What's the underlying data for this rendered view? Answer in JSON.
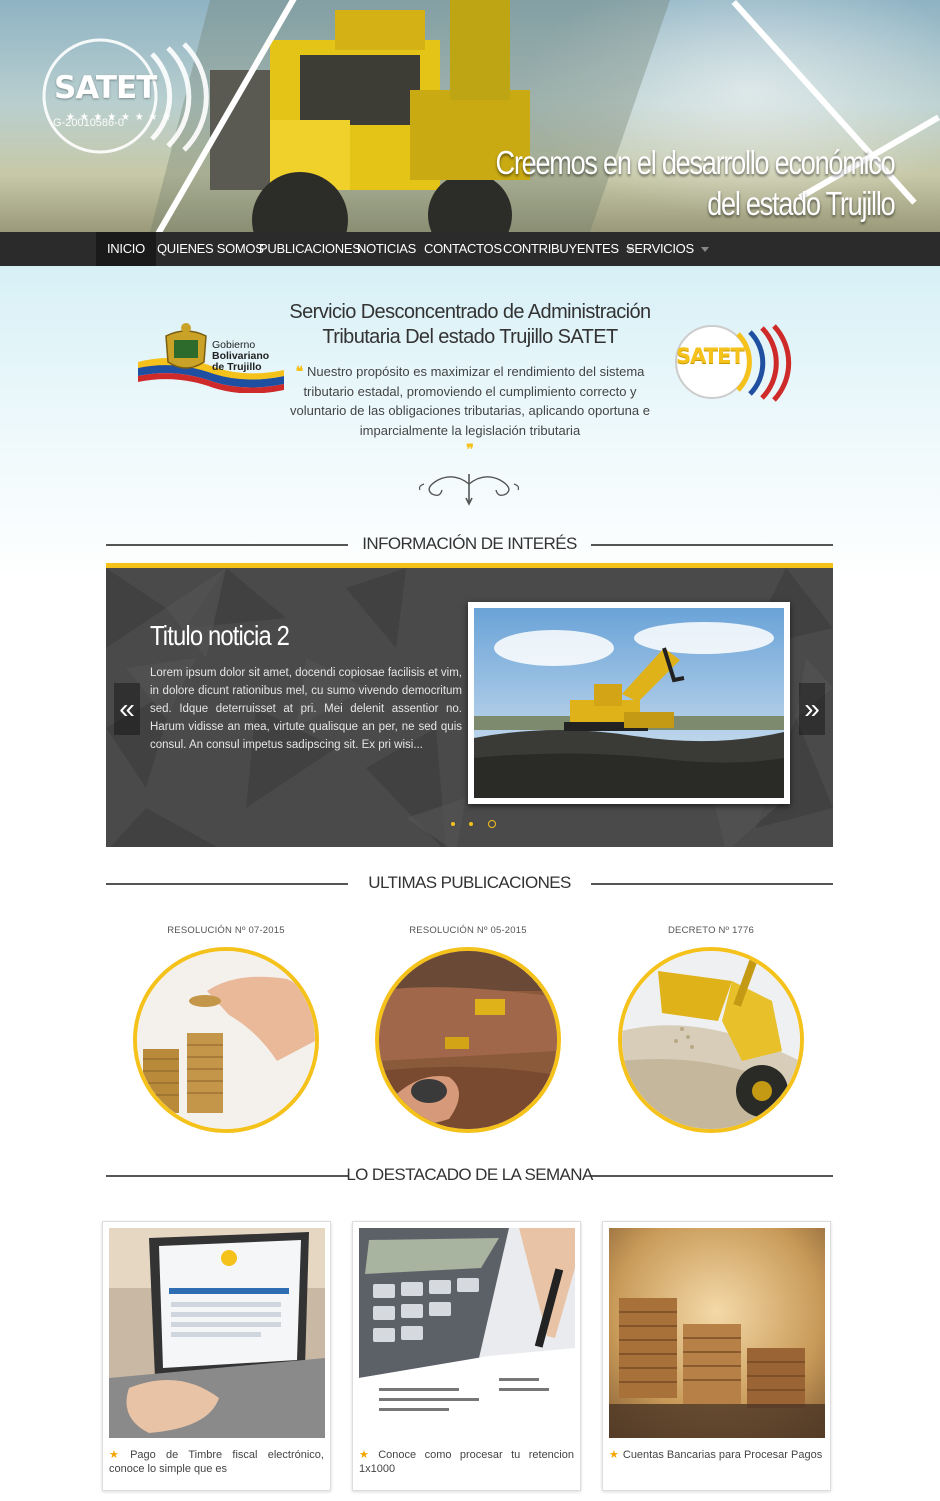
{
  "header": {
    "logo_text": "SATET",
    "logo_rif": "G-20010586-0",
    "tagline_line1": "Creemos en el desarrollo económico",
    "tagline_line2": "del estado Trujillo"
  },
  "nav": {
    "items": [
      {
        "label": "INICIO"
      },
      {
        "label": "QUIENES SOMOS"
      },
      {
        "label": "PUBLICACIONES"
      },
      {
        "label": "NOTICIAS"
      },
      {
        "label": "CONTACTOS"
      },
      {
        "label": "CONTRIBUYENTES"
      },
      {
        "label": "SERVICIOS"
      }
    ]
  },
  "intro": {
    "title_line1": "Servicio Desconcentrado de Administración",
    "title_line2": "Tributaria Del estado Trujillo SATET",
    "quote": "Nuestro propósito es maximizar el rendimiento del sistema tributario estadal, promoviendo el cumplimiento correcto y voluntario de las obligaciones tributarias, aplicando oportuna e imparcialmente la legislación tributaria",
    "gob_line1": "Gobierno",
    "gob_line2": "Bolivariano",
    "gob_line3": "de Trujillo",
    "satet_badge": "SATET"
  },
  "sections": {
    "info": "INFORMACIÓN DE INTERÉS",
    "publications": "ULTIMAS PUBLICACIONES",
    "featured": "LO DESTACADO DE LA SEMANA"
  },
  "slider": {
    "title": "Titulo noticia 2",
    "text": "Lorem ipsum dolor sit amet, docendi copiosae facilisis et vim, in dolore dicunt rationibus mel, cu sumo vivendo democritum sed. Idque deterruisset at pri. Mei delenit assentior no. Harum vidisse an mea, virtute qualisque an per, ne sed quis consul. An consul impetus sadipscing sit. Ex pri wisi...",
    "prev": "«",
    "next": "»",
    "current_slide": 3,
    "slide_count": 3
  },
  "publications": [
    {
      "label": "RESOLUCIÓN Nº 07-2015"
    },
    {
      "label": "RESOLUCIÓN Nº 05-2015"
    },
    {
      "label": "DECRETO Nº 1776"
    }
  ],
  "featured": [
    {
      "caption": "Pago de Timbre fiscal electrónico, conoce lo simple que es"
    },
    {
      "caption": "Conoce como procesar tu retencion 1x1000"
    },
    {
      "caption": "Cuentas Bancarias para Procesar Pagos"
    }
  ],
  "colors": {
    "accent": "#f5c11b",
    "nav_bg": "#2b2b2b",
    "slider_bg": "#4a4a4a"
  }
}
